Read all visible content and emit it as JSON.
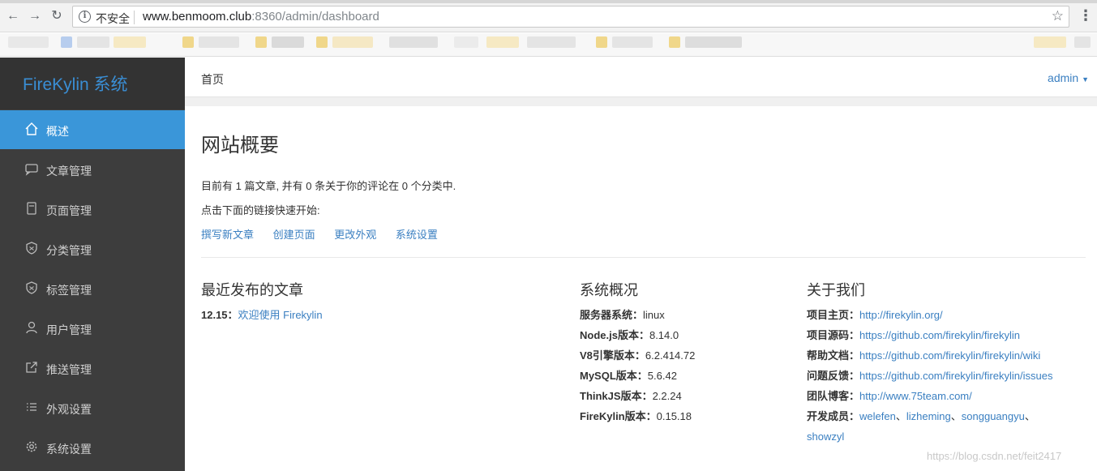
{
  "browser": {
    "insecure_label": "不安全",
    "url_host": "www.benmoom.club",
    "url_rest": ":8360/admin/dashboard"
  },
  "sidebar": {
    "brand": "FireKylin 系统",
    "items": [
      {
        "label": "概述",
        "icon": "home-icon",
        "active": true
      },
      {
        "label": "文章管理",
        "icon": "comment-icon"
      },
      {
        "label": "页面管理",
        "icon": "page-icon"
      },
      {
        "label": "分类管理",
        "icon": "shield-icon"
      },
      {
        "label": "标签管理",
        "icon": "shield-icon"
      },
      {
        "label": "用户管理",
        "icon": "user-icon"
      },
      {
        "label": "推送管理",
        "icon": "external-link-icon"
      },
      {
        "label": "外观设置",
        "icon": "list-icon"
      },
      {
        "label": "系统设置",
        "icon": "gear-icon"
      }
    ]
  },
  "topbar": {
    "home": "首页",
    "user": "admin"
  },
  "main": {
    "title": "网站概要",
    "intro_line1": "目前有 1 篇文章, 并有 0 条关于你的评论在 0 个分类中.",
    "intro_line2": "点击下面的链接快速开始:",
    "quick_links": [
      "撰写新文章",
      "创建页面",
      "更改外观",
      "系统设置"
    ]
  },
  "recent": {
    "title": "最近发布的文章",
    "posts": [
      {
        "date": "12.15：",
        "title": "欢迎使用 Firekylin"
      }
    ]
  },
  "system": {
    "title": "系统概况",
    "rows": [
      {
        "key": "服务器系统：",
        "value": "linux"
      },
      {
        "key": "Node.js版本：",
        "value": "8.14.0"
      },
      {
        "key": "V8引擎版本：",
        "value": "6.2.414.72"
      },
      {
        "key": "MySQL版本：",
        "value": "5.6.42"
      },
      {
        "key": "ThinkJS版本：",
        "value": "2.2.24"
      },
      {
        "key": "FireKylin版本：",
        "value": "0.15.18"
      }
    ]
  },
  "about": {
    "title": "关于我们",
    "rows": [
      {
        "key": "项目主页：",
        "value": "http://firekylin.org/"
      },
      {
        "key": "项目源码：",
        "value": "https://github.com/firekylin/firekylin"
      },
      {
        "key": "帮助文档：",
        "value": "https://github.com/firekylin/firekylin/wiki"
      },
      {
        "key": "问题反馈：",
        "value": "https://github.com/firekylin/firekylin/issues"
      },
      {
        "key": "团队博客：",
        "value": "http://www.75team.com/"
      }
    ],
    "members_key": "开发成员：",
    "members": [
      "welefen",
      "lizheming",
      "songguangyu",
      "showzyl"
    ],
    "member_sep": "、"
  },
  "watermark": "https://blog.csdn.net/feit2417",
  "colors": {
    "sidebar_bg": "#3d3d3d",
    "brand_bg": "#333333",
    "active_item": "#3a96d9",
    "link": "#3a7fc1"
  }
}
